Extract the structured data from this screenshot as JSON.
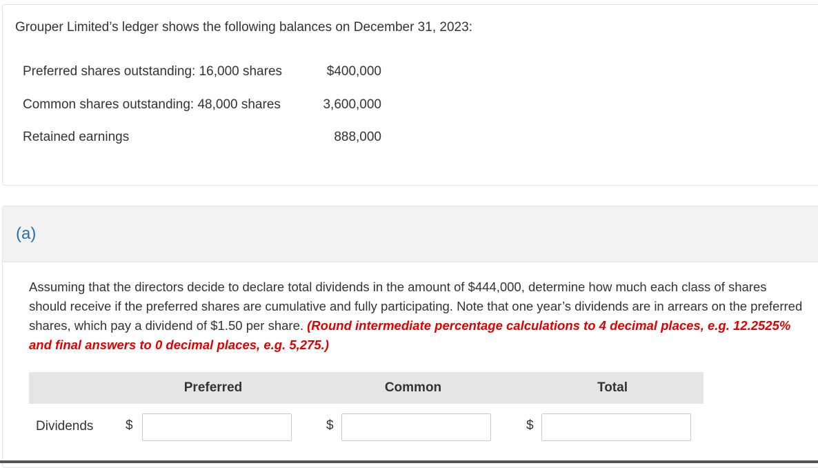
{
  "intro": "Grouper Limited’s ledger shows the following balances on December 31, 2023:",
  "balances": [
    {
      "label": "Preferred shares outstanding: 16,000 shares",
      "value": "$400,000"
    },
    {
      "label": "Common shares outstanding: 48,000 shares",
      "value": "3,600,000"
    },
    {
      "label": "Retained earnings",
      "value": "888,000"
    }
  ],
  "part": {
    "label": "(a)",
    "question": "Assuming that the directors decide to declare total dividends in the amount of $444,000, determine how much each class of shares should receive if the preferred shares are cumulative and fully participating. Note that one year’s dividends are in arrears on the preferred shares, which pay a dividend of $1.50 per share.",
    "hint": "(Round intermediate percentage calculations to 4 decimal places, e.g. 12.2525% and final answers to 0 decimal places, e.g. 5,275.)"
  },
  "table": {
    "columns": [
      "Preferred",
      "Common",
      "Total"
    ],
    "row_label": "Dividends",
    "currency": "$",
    "values": [
      "",
      "",
      ""
    ]
  },
  "colors": {
    "accent": "#2a6fa8",
    "hint": "#e00000",
    "header_bg": "#e5e5e5"
  }
}
